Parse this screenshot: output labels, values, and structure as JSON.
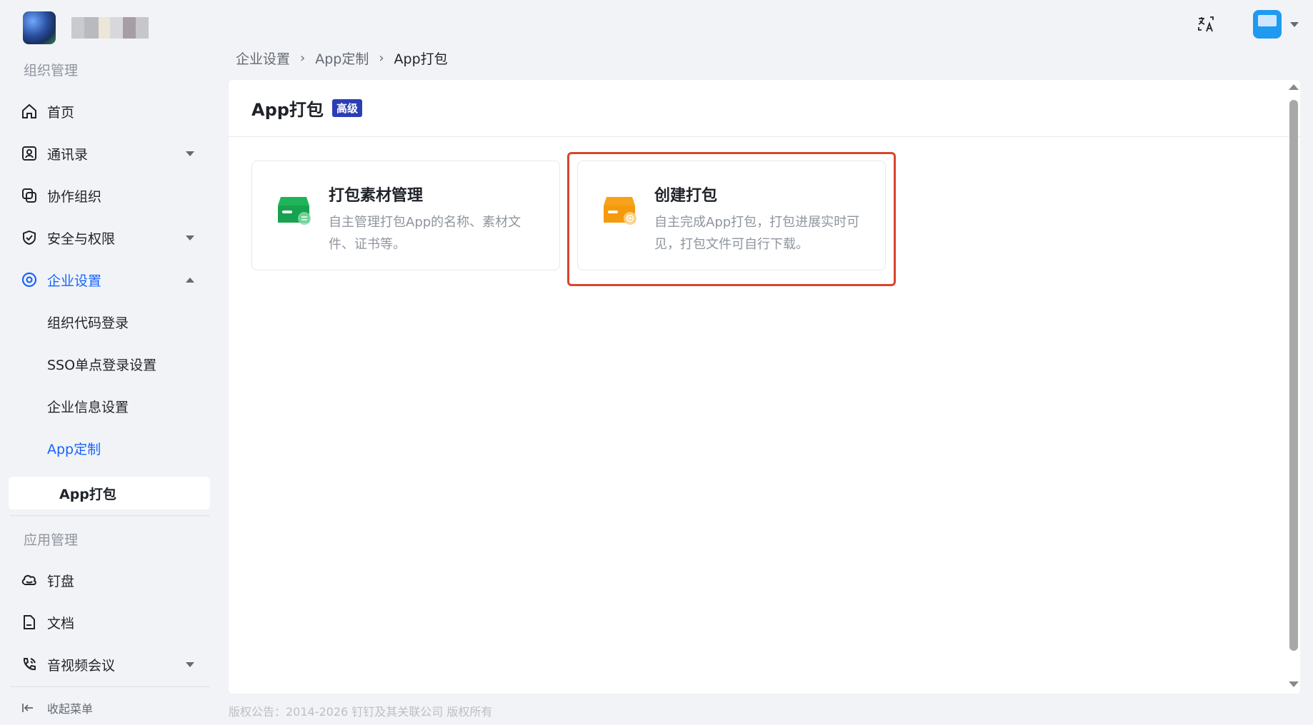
{
  "sidebar": {
    "section_org": "组织管理",
    "items": [
      {
        "label": "首页",
        "icon": "home-icon"
      },
      {
        "label": "通讯录",
        "icon": "contacts-icon"
      },
      {
        "label": "协作组织",
        "icon": "collab-org-icon"
      },
      {
        "label": "安全与权限",
        "icon": "shield-icon"
      },
      {
        "label": "企业设置",
        "icon": "settings-icon"
      }
    ],
    "enterprise_sub": [
      {
        "label": "组织代码登录"
      },
      {
        "label": "SSO单点登录设置"
      },
      {
        "label": "企业信息设置"
      },
      {
        "label": "App定制"
      }
    ],
    "app_sub_selected": "App打包",
    "section_apps": "应用管理",
    "app_items": [
      {
        "label": "钉盘",
        "icon": "cloud-disk-icon"
      },
      {
        "label": "文档",
        "icon": "document-icon"
      },
      {
        "label": "音视频会议",
        "icon": "video-call-icon"
      }
    ],
    "collapse_label": "收起菜单"
  },
  "breadcrumb": {
    "items": [
      "企业设置",
      "App定制"
    ],
    "current": "App打包"
  },
  "panel": {
    "title": "App打包",
    "badge": "高级",
    "cards": [
      {
        "title": "打包素材管理",
        "desc": "自主管理打包App的名称、素材文件、证书等。",
        "color": "#1fb45a"
      },
      {
        "title": "创建打包",
        "desc": "自主完成App打包，打包进展实时可见，打包文件可自行下载。",
        "color": "#f7a21a"
      }
    ]
  },
  "footer": "版权公告：2014-2026 钉钉及其关联公司 版权所有",
  "colors": {
    "accent": "#1664ff",
    "highlight": "#d9452c"
  }
}
